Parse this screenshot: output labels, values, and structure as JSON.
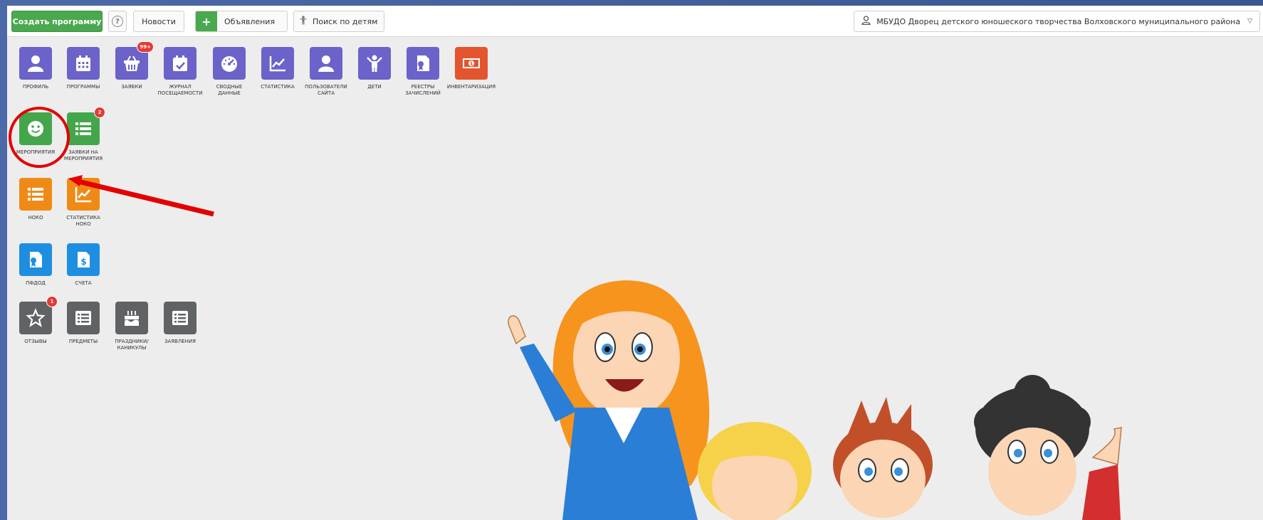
{
  "topbar": {
    "create_label": "Создать программу",
    "help_icon": "?",
    "news_label": "Новости",
    "announcements_label": "Объявления",
    "search_children_label": "Поиск по детям",
    "organization": "МБУДО Дворец детского юношеского творчества Волховского муниципального района"
  },
  "tiles": {
    "profile": "ПРОФИЛЬ",
    "programs": "ПРОГРАММЫ",
    "requests": "ЗАЯВКИ",
    "requests_badge": "99+",
    "attendance": "ЖУРНАЛ\nПОСЕЩАЕМОСТИ",
    "summary": "СВОДНЫЕ\nДАННЫЕ",
    "stats": "СТАТИСТИКА",
    "site_users": "ПОЛЬЗОВАТЕЛИ\nСАЙТА",
    "children": "ДЕТИ",
    "registries": "РЕЕСТРЫ\nЗАЧИСЛЕНИЙ",
    "inventory": "ИНВЕНТАРИЗАЦИЯ",
    "events": "МЕРОПРИЯТИЯ",
    "event_requests": "ЗАЯВКИ НА\nМЕРОПРИЯТИЯ",
    "event_requests_badge": "2",
    "noko": "НОКО",
    "noko_stats": "СТАТИСТИКА\nНОКО",
    "pfdod": "ПФДОД",
    "accounts": "СЧЕТА",
    "reviews": "ОТЗЫВЫ",
    "reviews_badge": "1",
    "subjects": "ПРЕДМЕТЫ",
    "holidays": "ПРАЗДНИКИ/\nКАНИКУЛЫ",
    "statements": "ЗАЯВЛЕНИЯ"
  },
  "colors": {
    "purple": "#6b63c9",
    "green": "#44a64a",
    "orange": "#f08a17",
    "blue": "#1e8fe0",
    "grey": "#5f6366",
    "red_annotation": "#e30000"
  },
  "icons": {
    "profile": "user-icon",
    "programs": "calendar-icon",
    "requests": "basket-icon",
    "attendance": "calendar-check-icon",
    "summary": "gauge-icon",
    "stats": "line-chart-icon",
    "site_users": "user-icon",
    "children": "child-icon",
    "registries": "certificate-icon",
    "inventory": "money-icon",
    "events": "smile-icon",
    "event_requests": "list-icon",
    "noko": "list-icon",
    "noko_stats": "line-chart-icon",
    "pfdod": "certificate-icon",
    "accounts": "invoice-icon",
    "reviews": "star-icon",
    "subjects": "list-box-icon",
    "holidays": "cake-icon",
    "statements": "list-box-icon"
  }
}
